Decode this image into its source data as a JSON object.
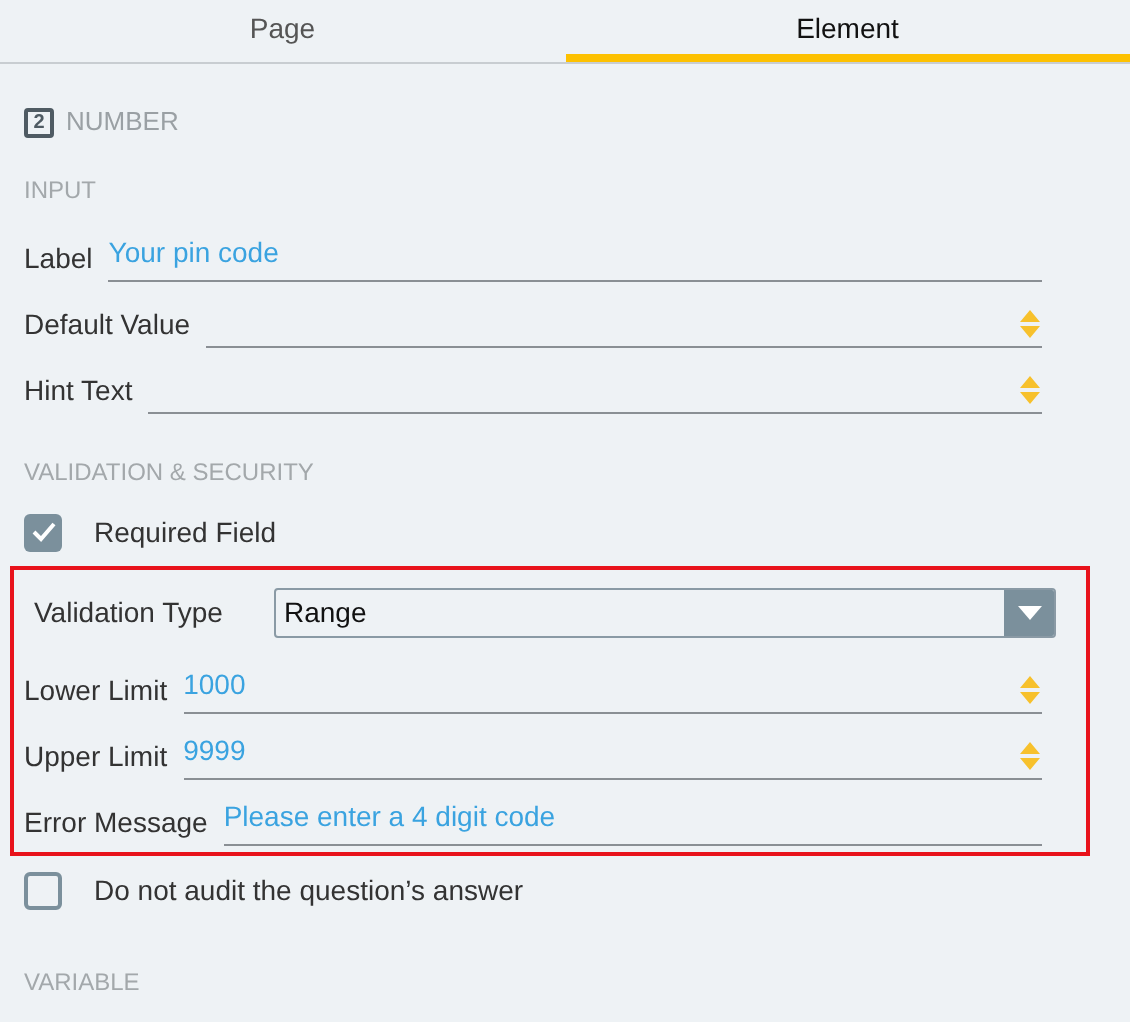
{
  "tabs": [
    {
      "label": "Page",
      "selected": false
    },
    {
      "label": "Element",
      "selected": true
    }
  ],
  "element_type": {
    "badge": "2",
    "label": "NUMBER"
  },
  "sections": [
    {
      "title": "INPUT",
      "rows": [
        {
          "kind": "text",
          "label": "Label",
          "value": "Your pin code"
        },
        {
          "kind": "number",
          "label": "Default Value"
        },
        {
          "kind": "number",
          "label": "Hint Text"
        }
      ]
    },
    {
      "title": "VALIDATION & SECURITY",
      "rows": [
        {
          "kind": "checkbox",
          "label": "Required Field",
          "checked": true
        },
        {
          "kind": "group",
          "highlighted": true,
          "rows": [
            {
              "kind": "select",
              "label": "Validation Type",
              "value": "Range"
            },
            {
              "kind": "number",
              "label": "Lower Limit",
              "value": "1000"
            },
            {
              "kind": "number",
              "label": "Upper Limit",
              "value": "9999"
            },
            {
              "kind": "text",
              "label": "Error Message",
              "value": "Please enter a 4 digit code"
            }
          ]
        },
        {
          "kind": "checkbox",
          "label": "Do not audit the question’s answer",
          "checked": false
        }
      ]
    },
    {
      "title": "VARIABLE"
    }
  ]
}
